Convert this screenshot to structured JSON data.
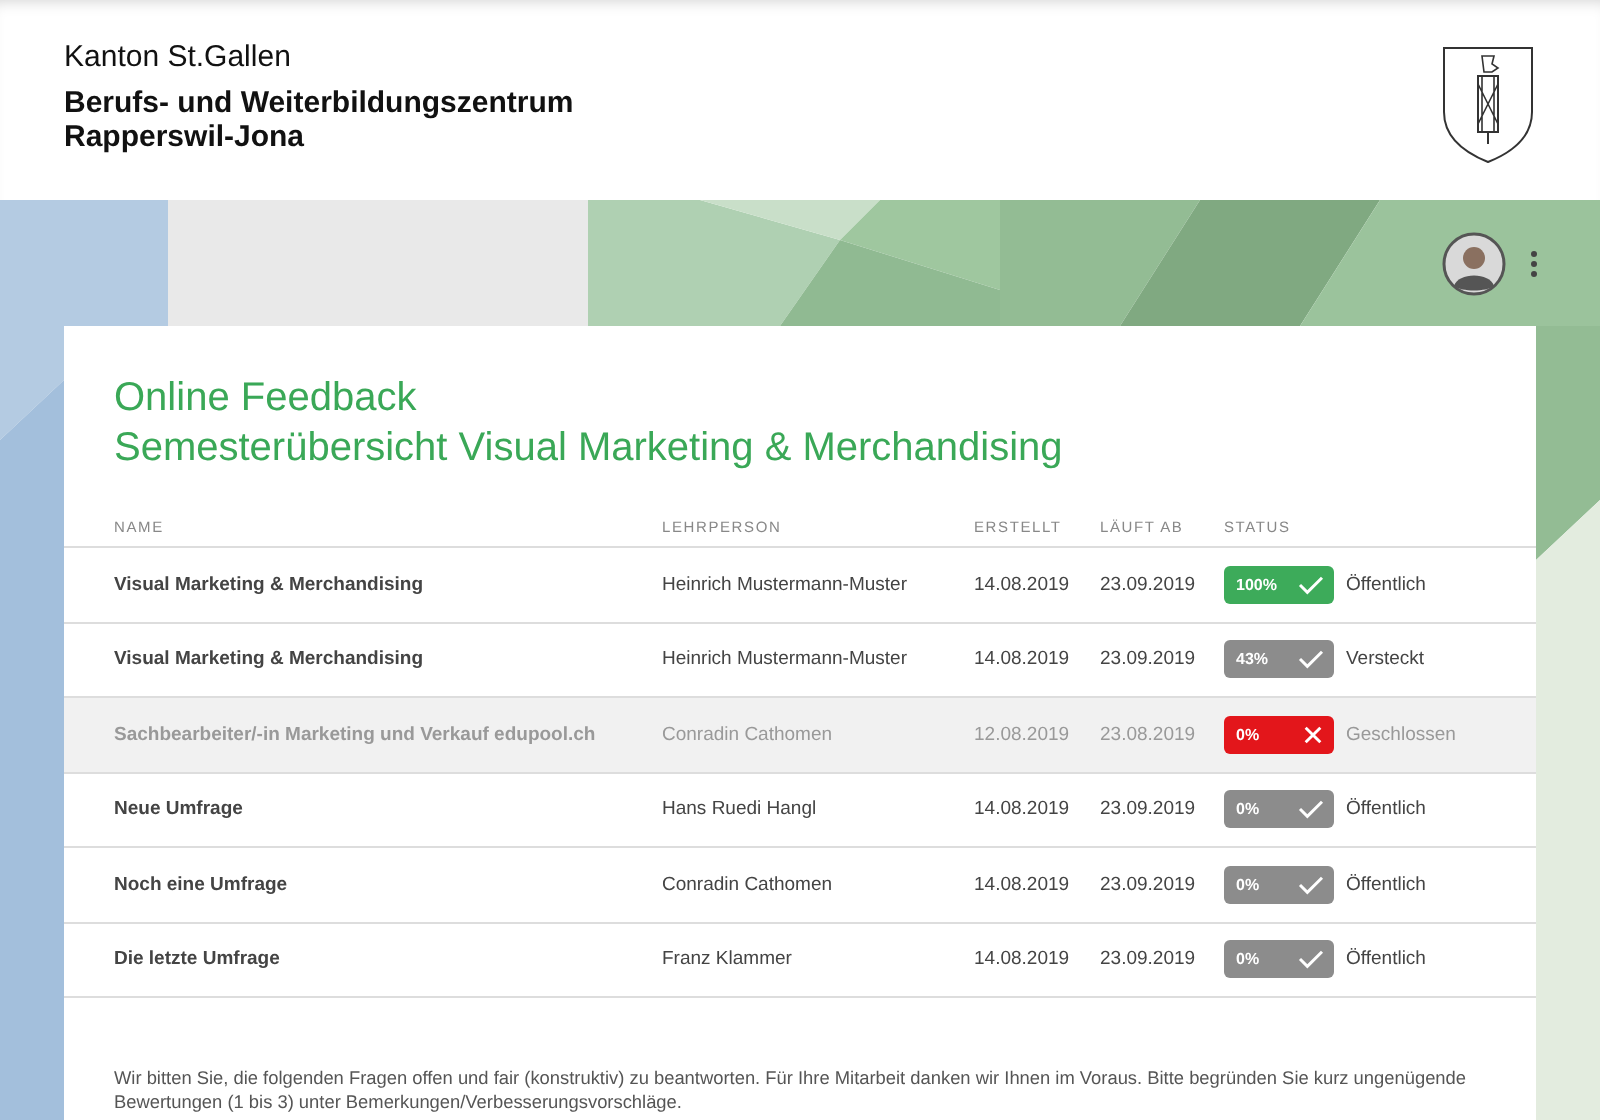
{
  "header": {
    "canton": "Kanton St.Gallen",
    "institution_line_1": "Berufs- und Weiterbildungszentrum",
    "institution_line_2": "Rapperswil-Jona"
  },
  "card": {
    "title": "Online Feedback",
    "subtitle": "Semesterübersicht Visual Marketing & Merchandising"
  },
  "table": {
    "columns": [
      "NAME",
      "LEHRPERSON",
      "ERSTELLT",
      "LÄUFT AB",
      "STATUS"
    ],
    "rows": [
      {
        "name": "Visual Marketing & Merchandising",
        "teacher": "Heinrich Mustermann-Muster",
        "created": "14.08.2019",
        "expires": "23.09.2019",
        "percent": "100%",
        "color": "#3dab5a",
        "closed": false,
        "visibility": "Öffentlich"
      },
      {
        "name": "Visual Marketing & Merchandising",
        "teacher": "Heinrich Mustermann-Muster",
        "created": "14.08.2019",
        "expires": "23.09.2019",
        "percent": "43%",
        "color": "#8c8c8c",
        "closed": false,
        "visibility": "Versteckt"
      },
      {
        "name": "Sachbearbeiter/-in Marketing und Verkauf edupool.ch",
        "teacher": "Conradin Cathomen",
        "created": "12.08.2019",
        "expires": "23.08.2019",
        "percent": "0%",
        "color": "#e3161b",
        "closed": true,
        "visibility": "Geschlossen"
      },
      {
        "name": "Neue Umfrage",
        "teacher": "Hans Ruedi Hangl",
        "created": "14.08.2019",
        "expires": "23.09.2019",
        "percent": "0%",
        "color": "#8c8c8c",
        "closed": false,
        "visibility": "Öffentlich"
      },
      {
        "name": "Noch eine Umfrage",
        "teacher": "Conradin Cathomen",
        "created": "14.08.2019",
        "expires": "23.09.2019",
        "percent": "0%",
        "color": "#8c8c8c",
        "closed": false,
        "visibility": "Öffentlich"
      },
      {
        "name": "Die letzte Umfrage",
        "teacher": "Franz Klammer",
        "created": "14.08.2019",
        "expires": "23.09.2019",
        "percent": "0%",
        "color": "#8c8c8c",
        "closed": false,
        "visibility": "Öffentlich"
      }
    ]
  },
  "note": "Wir bitten Sie, die folgenden Fragen offen und fair (konstruktiv) zu beantworten. Für Ihre Mitarbeit danken wir Ihnen im Voraus. Bitte begründen Sie kurz ungenügende Bewertungen (1 bis 3) unter Bemerkungen/Verbesserungsvorschläge."
}
